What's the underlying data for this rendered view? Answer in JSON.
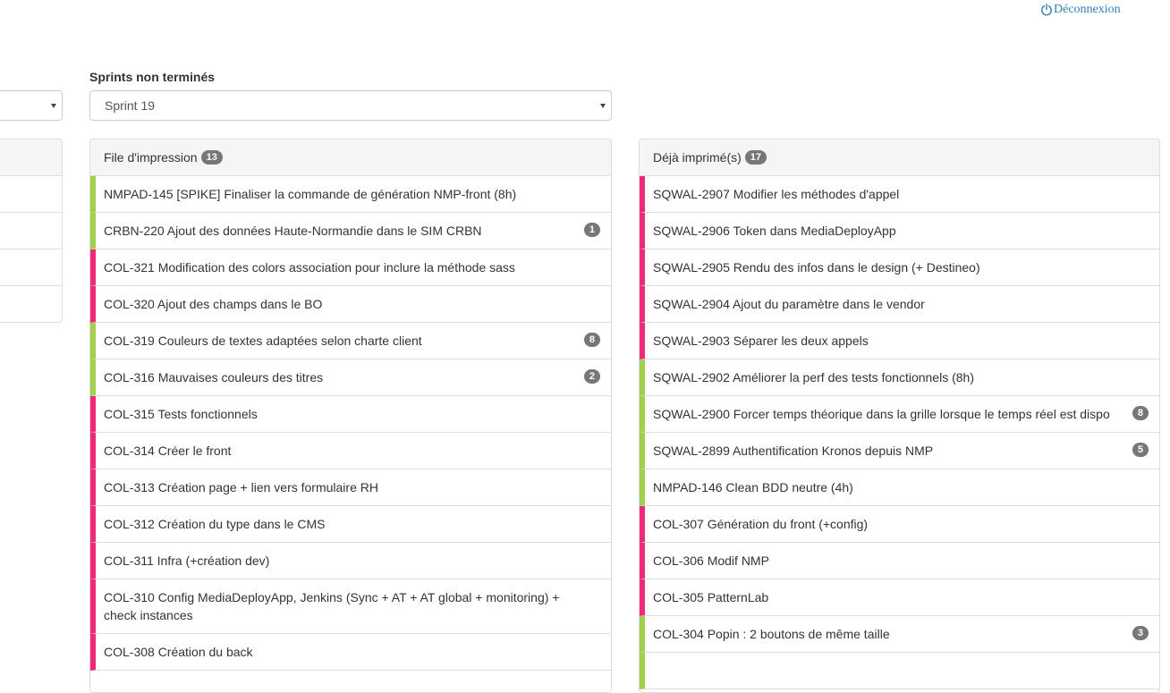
{
  "header": {
    "logout_label": "Déconnexion"
  },
  "sprint_filter": {
    "label": "Sprints non terminés",
    "selected": "Sprint 19"
  },
  "queue_panel": {
    "title": "File d'impression",
    "count": "13",
    "items": [
      {
        "text": "NMPAD-145 [SPIKE] Finaliser la commande de génération NMP-front (8h)",
        "badge": "",
        "color": "#a3d04c"
      },
      {
        "text": "CRBN-220 Ajout des données Haute-Normandie dans le SIM CRBN",
        "badge": "1",
        "color": "#a3d04c"
      },
      {
        "text": "COL-321 Modification des colors association pour inclure la méthode sass",
        "badge": "",
        "color": "#f0287d"
      },
      {
        "text": "COL-320 Ajout des champs dans le BO",
        "badge": "",
        "color": "#f0287d"
      },
      {
        "text": "COL-319 Couleurs de textes adaptées selon charte client",
        "badge": "8",
        "color": "#a3d04c"
      },
      {
        "text": "COL-316 Mauvaises couleurs des titres",
        "badge": "2",
        "color": "#a3d04c"
      },
      {
        "text": "COL-315 Tests fonctionnels",
        "badge": "",
        "color": "#f0287d"
      },
      {
        "text": "COL-314 Créer le front",
        "badge": "",
        "color": "#f0287d"
      },
      {
        "text": "COL-313 Création page + lien vers formulaire RH",
        "badge": "",
        "color": "#f0287d"
      },
      {
        "text": "COL-312 Création du type dans le CMS",
        "badge": "",
        "color": "#f0287d"
      },
      {
        "text": "COL-311 Infra (+création dev)",
        "badge": "",
        "color": "#f0287d"
      },
      {
        "text": "COL-310 Config MediaDeployApp, Jenkins (Sync + AT + AT global + monitoring) + check instances",
        "badge": "",
        "color": "#f0287d"
      },
      {
        "text": "COL-308 Création du back",
        "badge": "",
        "color": "#f0287d"
      }
    ]
  },
  "printed_panel": {
    "title": "Déjà imprimé(s)",
    "count": "17",
    "items": [
      {
        "text": "SQWAL-2907 Modifier les méthodes d'appel",
        "badge": "",
        "color": "#f0287d"
      },
      {
        "text": "SQWAL-2906 Token dans MediaDeployApp",
        "badge": "",
        "color": "#f0287d"
      },
      {
        "text": "SQWAL-2905 Rendu des infos dans le design (+ Destineo)",
        "badge": "",
        "color": "#f0287d"
      },
      {
        "text": "SQWAL-2904 Ajout du paramètre dans le vendor",
        "badge": "",
        "color": "#f0287d"
      },
      {
        "text": "SQWAL-2903 Séparer les deux appels",
        "badge": "",
        "color": "#f0287d"
      },
      {
        "text": "SQWAL-2902 Améliorer la perf des tests fonctionnels (8h)",
        "badge": "",
        "color": "#a3d04c"
      },
      {
        "text": "SQWAL-2900 Forcer temps théorique dans la grille lorsque le temps réel est dispo",
        "badge": "8",
        "color": "#a3d04c"
      },
      {
        "text": "SQWAL-2899 Authentification Kronos depuis NMP",
        "badge": "5",
        "color": "#a3d04c"
      },
      {
        "text": "NMPAD-146 Clean BDD neutre (4h)",
        "badge": "",
        "color": "#a3d04c"
      },
      {
        "text": "COL-307 Génération du front (+config)",
        "badge": "",
        "color": "#f0287d"
      },
      {
        "text": "COL-306 Modif NMP",
        "badge": "",
        "color": "#f0287d"
      },
      {
        "text": "COL-305 PatternLab",
        "badge": "",
        "color": "#f0287d"
      },
      {
        "text": "COL-304 Popin : 2 boutons de même taille",
        "badge": "3",
        "color": "#a3d04c"
      },
      {
        "text": "",
        "badge": "",
        "color": "#a3d04c"
      }
    ]
  }
}
